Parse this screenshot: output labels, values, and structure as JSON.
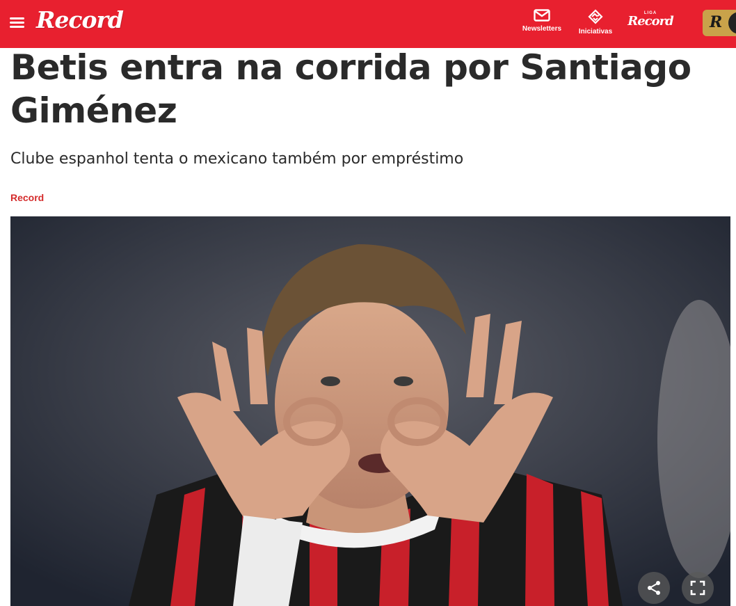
{
  "header": {
    "logo_text": "Record",
    "newsletters_label": "Newsletters",
    "iniciativas_label": "Iniciativas",
    "liga_small": "LIGA",
    "liga_logo_text": "Record",
    "rplus_letter": "R"
  },
  "article": {
    "title": "Betis entra na corrida por Santiago Giménez",
    "subtitle": "Clube espanhol tenta o mexicano também por empréstimo",
    "author": "Record"
  },
  "colors": {
    "brand_red": "#e8202f",
    "author_red": "#d42b2b",
    "gold": "#c9a24a"
  },
  "icons": {
    "menu": "hamburger-icon",
    "newsletters": "envelope-icon",
    "iniciativas": "handshake-icon",
    "share": "share-icon",
    "fullscreen": "fullscreen-icon"
  }
}
